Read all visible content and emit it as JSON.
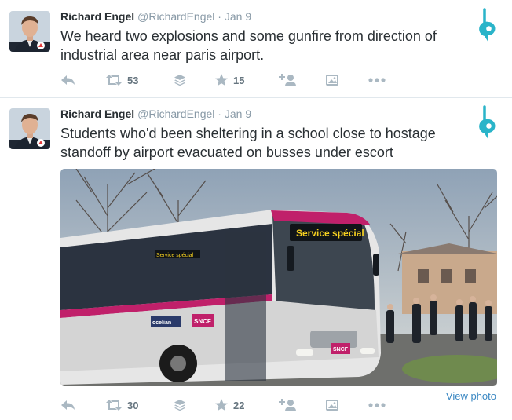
{
  "tweets": [
    {
      "name": "Richard Engel",
      "handle": "@RichardEngel",
      "separator": "·",
      "time": "Jan 9",
      "text": "We heard two explosions and some gunfire from direction of industrial area near paris airport.",
      "retweet_count": "53",
      "favorite_count": "15"
    },
    {
      "name": "Richard Engel",
      "handle": "@RichardEngel",
      "separator": "·",
      "time": "Jan 9",
      "text": "Students who'd been sheltering in a school close to hostage standoff by airport evacuated on busses under escort",
      "retweet_count": "30",
      "favorite_count": "22",
      "media": {
        "sign_text": "Service spécial",
        "interior_sign_text": "Service spécial",
        "brand_text": "SNCF",
        "operator_text": "ocelian"
      },
      "view_photo_label": "View photo"
    }
  ],
  "icons": {
    "logo": "bluebird-b-logo-icon",
    "reply": "reply-arrow-icon",
    "retweet": "retweet-icon",
    "buffer": "layers-icon",
    "favorite": "star-icon",
    "follow": "add-person-icon",
    "media": "image-icon",
    "more": "more-dots-icon"
  },
  "colors": {
    "logo": "#2ab4c9",
    "action_icon": "#aab8c2",
    "link": "#3b88c3",
    "bus_magenta": "#c0206a"
  }
}
